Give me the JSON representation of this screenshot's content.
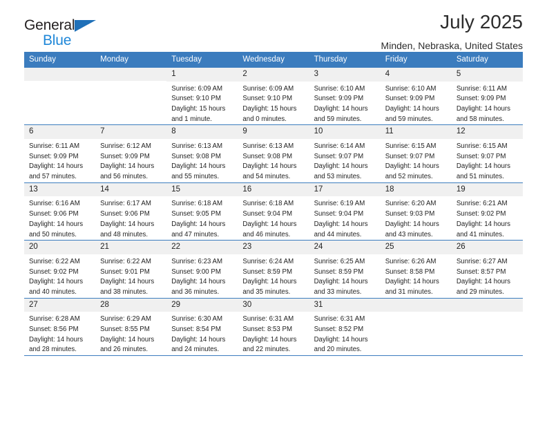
{
  "brand": {
    "name_dark": "General",
    "name_blue": "Blue",
    "triangle_icon": "triangle-logo-icon"
  },
  "header": {
    "title": "July 2025",
    "subtitle": "Minden, Nebraska, United States"
  },
  "colors": {
    "header_blue": "#3b7cbe",
    "brand_blue": "#1f87d8",
    "logo_triangle_blue": "#1f70b8",
    "daynum_band": "#f0f0f0",
    "text": "#1f1f1f"
  },
  "weekdays": [
    "Sunday",
    "Monday",
    "Tuesday",
    "Wednesday",
    "Thursday",
    "Friday",
    "Saturday"
  ],
  "weeks": [
    [
      {
        "day": "",
        "sunrise": "",
        "sunset": "",
        "daylight_line1": "",
        "daylight_line2": "",
        "empty": true
      },
      {
        "day": "",
        "sunrise": "",
        "sunset": "",
        "daylight_line1": "",
        "daylight_line2": "",
        "empty": true
      },
      {
        "day": "1",
        "sunrise": "Sunrise: 6:09 AM",
        "sunset": "Sunset: 9:10 PM",
        "daylight_line1": "Daylight: 15 hours",
        "daylight_line2": "and 1 minute."
      },
      {
        "day": "2",
        "sunrise": "Sunrise: 6:09 AM",
        "sunset": "Sunset: 9:10 PM",
        "daylight_line1": "Daylight: 15 hours",
        "daylight_line2": "and 0 minutes."
      },
      {
        "day": "3",
        "sunrise": "Sunrise: 6:10 AM",
        "sunset": "Sunset: 9:09 PM",
        "daylight_line1": "Daylight: 14 hours",
        "daylight_line2": "and 59 minutes."
      },
      {
        "day": "4",
        "sunrise": "Sunrise: 6:10 AM",
        "sunset": "Sunset: 9:09 PM",
        "daylight_line1": "Daylight: 14 hours",
        "daylight_line2": "and 59 minutes."
      },
      {
        "day": "5",
        "sunrise": "Sunrise: 6:11 AM",
        "sunset": "Sunset: 9:09 PM",
        "daylight_line1": "Daylight: 14 hours",
        "daylight_line2": "and 58 minutes."
      }
    ],
    [
      {
        "day": "6",
        "sunrise": "Sunrise: 6:11 AM",
        "sunset": "Sunset: 9:09 PM",
        "daylight_line1": "Daylight: 14 hours",
        "daylight_line2": "and 57 minutes."
      },
      {
        "day": "7",
        "sunrise": "Sunrise: 6:12 AM",
        "sunset": "Sunset: 9:09 PM",
        "daylight_line1": "Daylight: 14 hours",
        "daylight_line2": "and 56 minutes."
      },
      {
        "day": "8",
        "sunrise": "Sunrise: 6:13 AM",
        "sunset": "Sunset: 9:08 PM",
        "daylight_line1": "Daylight: 14 hours",
        "daylight_line2": "and 55 minutes."
      },
      {
        "day": "9",
        "sunrise": "Sunrise: 6:13 AM",
        "sunset": "Sunset: 9:08 PM",
        "daylight_line1": "Daylight: 14 hours",
        "daylight_line2": "and 54 minutes."
      },
      {
        "day": "10",
        "sunrise": "Sunrise: 6:14 AM",
        "sunset": "Sunset: 9:07 PM",
        "daylight_line1": "Daylight: 14 hours",
        "daylight_line2": "and 53 minutes."
      },
      {
        "day": "11",
        "sunrise": "Sunrise: 6:15 AM",
        "sunset": "Sunset: 9:07 PM",
        "daylight_line1": "Daylight: 14 hours",
        "daylight_line2": "and 52 minutes."
      },
      {
        "day": "12",
        "sunrise": "Sunrise: 6:15 AM",
        "sunset": "Sunset: 9:07 PM",
        "daylight_line1": "Daylight: 14 hours",
        "daylight_line2": "and 51 minutes."
      }
    ],
    [
      {
        "day": "13",
        "sunrise": "Sunrise: 6:16 AM",
        "sunset": "Sunset: 9:06 PM",
        "daylight_line1": "Daylight: 14 hours",
        "daylight_line2": "and 50 minutes."
      },
      {
        "day": "14",
        "sunrise": "Sunrise: 6:17 AM",
        "sunset": "Sunset: 9:06 PM",
        "daylight_line1": "Daylight: 14 hours",
        "daylight_line2": "and 48 minutes."
      },
      {
        "day": "15",
        "sunrise": "Sunrise: 6:18 AM",
        "sunset": "Sunset: 9:05 PM",
        "daylight_line1": "Daylight: 14 hours",
        "daylight_line2": "and 47 minutes."
      },
      {
        "day": "16",
        "sunrise": "Sunrise: 6:18 AM",
        "sunset": "Sunset: 9:04 PM",
        "daylight_line1": "Daylight: 14 hours",
        "daylight_line2": "and 46 minutes."
      },
      {
        "day": "17",
        "sunrise": "Sunrise: 6:19 AM",
        "sunset": "Sunset: 9:04 PM",
        "daylight_line1": "Daylight: 14 hours",
        "daylight_line2": "and 44 minutes."
      },
      {
        "day": "18",
        "sunrise": "Sunrise: 6:20 AM",
        "sunset": "Sunset: 9:03 PM",
        "daylight_line1": "Daylight: 14 hours",
        "daylight_line2": "and 43 minutes."
      },
      {
        "day": "19",
        "sunrise": "Sunrise: 6:21 AM",
        "sunset": "Sunset: 9:02 PM",
        "daylight_line1": "Daylight: 14 hours",
        "daylight_line2": "and 41 minutes."
      }
    ],
    [
      {
        "day": "20",
        "sunrise": "Sunrise: 6:22 AM",
        "sunset": "Sunset: 9:02 PM",
        "daylight_line1": "Daylight: 14 hours",
        "daylight_line2": "and 40 minutes."
      },
      {
        "day": "21",
        "sunrise": "Sunrise: 6:22 AM",
        "sunset": "Sunset: 9:01 PM",
        "daylight_line1": "Daylight: 14 hours",
        "daylight_line2": "and 38 minutes."
      },
      {
        "day": "22",
        "sunrise": "Sunrise: 6:23 AM",
        "sunset": "Sunset: 9:00 PM",
        "daylight_line1": "Daylight: 14 hours",
        "daylight_line2": "and 36 minutes."
      },
      {
        "day": "23",
        "sunrise": "Sunrise: 6:24 AM",
        "sunset": "Sunset: 8:59 PM",
        "daylight_line1": "Daylight: 14 hours",
        "daylight_line2": "and 35 minutes."
      },
      {
        "day": "24",
        "sunrise": "Sunrise: 6:25 AM",
        "sunset": "Sunset: 8:59 PM",
        "daylight_line1": "Daylight: 14 hours",
        "daylight_line2": "and 33 minutes."
      },
      {
        "day": "25",
        "sunrise": "Sunrise: 6:26 AM",
        "sunset": "Sunset: 8:58 PM",
        "daylight_line1": "Daylight: 14 hours",
        "daylight_line2": "and 31 minutes."
      },
      {
        "day": "26",
        "sunrise": "Sunrise: 6:27 AM",
        "sunset": "Sunset: 8:57 PM",
        "daylight_line1": "Daylight: 14 hours",
        "daylight_line2": "and 29 minutes."
      }
    ],
    [
      {
        "day": "27",
        "sunrise": "Sunrise: 6:28 AM",
        "sunset": "Sunset: 8:56 PM",
        "daylight_line1": "Daylight: 14 hours",
        "daylight_line2": "and 28 minutes."
      },
      {
        "day": "28",
        "sunrise": "Sunrise: 6:29 AM",
        "sunset": "Sunset: 8:55 PM",
        "daylight_line1": "Daylight: 14 hours",
        "daylight_line2": "and 26 minutes."
      },
      {
        "day": "29",
        "sunrise": "Sunrise: 6:30 AM",
        "sunset": "Sunset: 8:54 PM",
        "daylight_line1": "Daylight: 14 hours",
        "daylight_line2": "and 24 minutes."
      },
      {
        "day": "30",
        "sunrise": "Sunrise: 6:31 AM",
        "sunset": "Sunset: 8:53 PM",
        "daylight_line1": "Daylight: 14 hours",
        "daylight_line2": "and 22 minutes."
      },
      {
        "day": "31",
        "sunrise": "Sunrise: 6:31 AM",
        "sunset": "Sunset: 8:52 PM",
        "daylight_line1": "Daylight: 14 hours",
        "daylight_line2": "and 20 minutes."
      },
      {
        "day": "",
        "sunrise": "",
        "sunset": "",
        "daylight_line1": "",
        "daylight_line2": "",
        "empty": true
      },
      {
        "day": "",
        "sunrise": "",
        "sunset": "",
        "daylight_line1": "",
        "daylight_line2": "",
        "empty": true
      }
    ]
  ]
}
